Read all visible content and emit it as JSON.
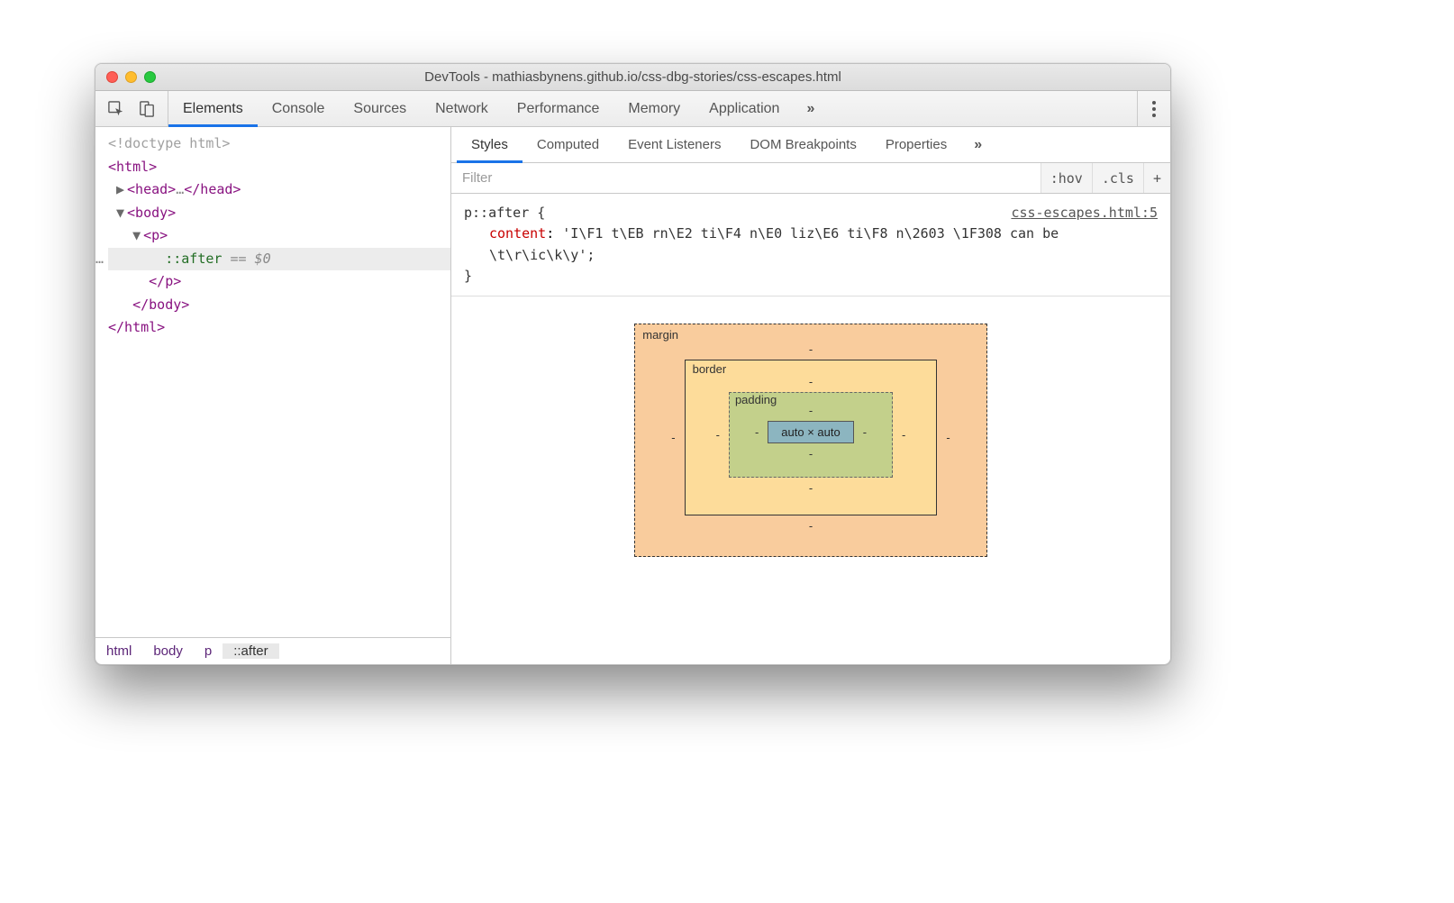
{
  "window": {
    "title": "DevTools - mathiasbynens.github.io/css-dbg-stories/css-escapes.html"
  },
  "toolbar": {
    "tabs": [
      "Elements",
      "Console",
      "Sources",
      "Network",
      "Performance",
      "Memory",
      "Application"
    ],
    "active": "Elements",
    "overflow": "»"
  },
  "dom": {
    "doctype": "<!doctype html>",
    "html_open": "<html>",
    "head": {
      "open": "<head>",
      "ellipsis": "…",
      "close": "</head>"
    },
    "body_open": "<body>",
    "p_open": "<p>",
    "after": "::after",
    "eq0": " == $0",
    "p_close": "</p>",
    "body_close": "</body>",
    "html_close": "</html>"
  },
  "breadcrumb": [
    "html",
    "body",
    "p",
    "::after"
  ],
  "styles_panel": {
    "tabs": [
      "Styles",
      "Computed",
      "Event Listeners",
      "DOM Breakpoints",
      "Properties"
    ],
    "active": "Styles",
    "overflow": "»",
    "filter_placeholder": "Filter",
    "hov": ":hov",
    "cls": ".cls",
    "plus": "+"
  },
  "rule": {
    "selector": "p::after {",
    "link": "css-escapes.html:5",
    "prop": "content",
    "value": "'I\\F1 t\\EB rn\\E2 ti\\F4 n\\E0 liz\\E6 ti\\F8 n\\2603 \\1F308 can be \\t\\r\\ic\\k\\y';",
    "close": "}"
  },
  "box_model": {
    "margin_label": "margin",
    "border_label": "border",
    "padding_label": "padding",
    "content": "auto × auto",
    "dash": "-"
  }
}
